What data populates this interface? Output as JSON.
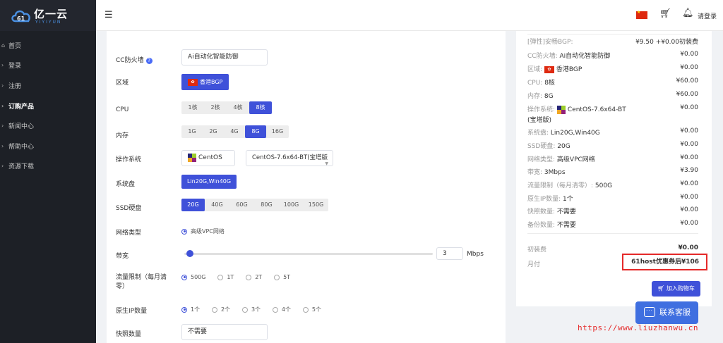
{
  "logo": {
    "text": "亿一云",
    "sub": "YIYIYUN"
  },
  "sidebar": {
    "items": [
      {
        "label": "首页"
      },
      {
        "label": "登录"
      },
      {
        "label": "注册"
      },
      {
        "label": "订购产品"
      },
      {
        "label": "新闻中心"
      },
      {
        "label": "帮助中心"
      },
      {
        "label": "资源下载"
      }
    ]
  },
  "topbar": {
    "login": "请登录"
  },
  "form": {
    "cc_label": "CC防火墙",
    "cc_value": "Ai自动化智能防御",
    "region_label": "区域",
    "region_value": "香港BGP",
    "cpu_label": "CPU",
    "cpu_options": [
      "1核",
      "2核",
      "4核",
      "8核"
    ],
    "mem_label": "内存",
    "mem_options": [
      "1G",
      "2G",
      "4G",
      "8G",
      "16G"
    ],
    "os_label": "操作系统",
    "os_name": "CentOS",
    "os_version": "CentOS-7.6x64-BT(宝塔版",
    "sysdisk_label": "系统盘",
    "sysdisk_value": "Lin20G,Win40G",
    "ssd_label": "SSD硬盘",
    "ssd_options": [
      "20G",
      "40G",
      "60G",
      "80G",
      "100G",
      "150G"
    ],
    "net_label": "网络类型",
    "net_value": "高级VPC网络",
    "bw_label": "带宽",
    "bw_value": "3",
    "bw_unit": "Mbps",
    "bw_level": 3,
    "traffic_label": "流量限制（每月清零）",
    "traffic_options": [
      "500G",
      "1T",
      "2T",
      "5T"
    ],
    "ip_label": "原生IP数量",
    "ip_options": [
      "1个",
      "2个",
      "3个",
      "4个",
      "5个"
    ],
    "snap_label": "快照数量",
    "snap_value": "不需要"
  },
  "summary": {
    "rows": [
      {
        "k": "[弹性]安畅BGP:",
        "v": "¥9.50 +¥0.00初装费"
      },
      {
        "k": "CC防火墙: ",
        "kv": "Ai自动化智能防御",
        "v": "¥0.00"
      },
      {
        "k": "区域: ",
        "kv": "香港BGP",
        "v": "¥0.00"
      },
      {
        "k": "CPU: ",
        "kv": "8核",
        "v": "¥60.00"
      },
      {
        "k": "内存: ",
        "kv": "8G",
        "v": "¥60.00"
      },
      {
        "k": "操作系统: ",
        "kv": "CentOS-7.6x64-BT",
        "v": "¥0.00"
      },
      {
        "k": "",
        "kv": "(宝塔版)",
        "v": ""
      },
      {
        "k": "系统盘: ",
        "kv": "Lin20G,Win40G",
        "v": "¥0.00"
      },
      {
        "k": "SSD硬盘: ",
        "kv": "20G",
        "v": "¥0.00"
      },
      {
        "k": "网络类型: ",
        "kv": "高级VPC网络",
        "v": "¥0.00"
      },
      {
        "k": "带宽: ",
        "kv": "3Mbps",
        "v": "¥3.90"
      },
      {
        "k": "流量限制（每月清零）: ",
        "kv": "500G",
        "v": "¥0.00"
      },
      {
        "k": "原生IP数量: ",
        "kv": "1个",
        "v": "¥0.00"
      },
      {
        "k": "快照数量: ",
        "kv": "不需要",
        "v": "¥0.00"
      },
      {
        "k": "备份数量: ",
        "kv": "不需要",
        "v": "¥0.00"
      }
    ],
    "setup_label": "初装费",
    "setup_value": "¥0.00",
    "monthly_label": "月付",
    "promo_text": "61host优惠券后¥106",
    "add_cart": "加入购物车"
  },
  "contact": "联系客服",
  "watermark": "https://www.liuzhanwu.cn"
}
